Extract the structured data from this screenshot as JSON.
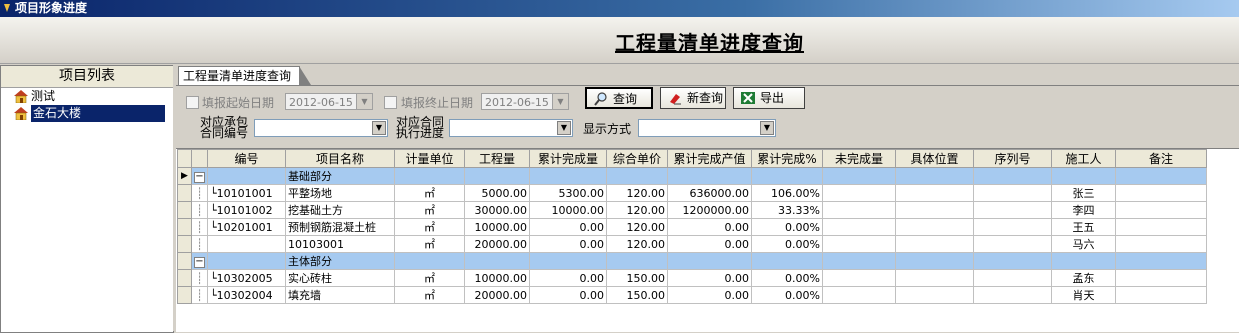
{
  "window": {
    "title": "项目形象进度"
  },
  "page": {
    "title": "工程量清单进度查询"
  },
  "sidebar": {
    "header": "项目列表",
    "items": [
      {
        "label": "测试"
      },
      {
        "label": "金石大楼"
      }
    ]
  },
  "tab": {
    "label": "工程量清单进度查询"
  },
  "filters": {
    "start_label": "填报起始日期",
    "start_value": "2012-06-15",
    "end_label": "填报终止日期",
    "end_value": "2012-06-15",
    "contract_label_1": "对应承包",
    "contract_label_2": "合同编号",
    "contract_value": "",
    "progress_label_1": "对应合同",
    "progress_label_2": "执行进度",
    "progress_value": "",
    "display_label": "显示方式",
    "display_value": ""
  },
  "buttons": {
    "query": "查询",
    "new_query": "新查询",
    "export": "导出"
  },
  "colors": {
    "title_bar": "#0a246a",
    "group_row": "#a6caf0",
    "selected": "#0a246a"
  },
  "table": {
    "columns": [
      "编号",
      "项目名称",
      "计量单位",
      "工程量",
      "累计完成量",
      "综合单价",
      "累计完成产值",
      "累计完成%",
      "未完成量",
      "具体位置",
      "序列号",
      "施工人",
      "备注"
    ],
    "rows": [
      {
        "type": "group",
        "name": "基础部分"
      },
      {
        "type": "item",
        "code": "10101001",
        "name": "平整场地",
        "unit": "㎡",
        "qty": "5000.00",
        "done": "5300.00",
        "price": "120.00",
        "value": "636000.00",
        "pct": "106.00%",
        "worker": "张三"
      },
      {
        "type": "item",
        "code": "10101002",
        "name": "挖基础土方",
        "unit": "㎡",
        "qty": "30000.00",
        "done": "10000.00",
        "price": "120.00",
        "value": "1200000.00",
        "pct": "33.33%",
        "worker": "李四"
      },
      {
        "type": "item",
        "code": "10201001",
        "name": "预制钢筋混凝土桩",
        "unit": "㎡",
        "qty": "10000.00",
        "done": "0.00",
        "price": "120.00",
        "value": "0.00",
        "pct": "0.00%",
        "worker": "王五"
      },
      {
        "type": "item",
        "code": "",
        "name": "10103001",
        "unit": "㎡",
        "qty": "20000.00",
        "done": "0.00",
        "price": "120.00",
        "value": "0.00",
        "pct": "0.00%",
        "worker": "马六"
      },
      {
        "type": "group",
        "name": "主体部分"
      },
      {
        "type": "item",
        "code": "10302005",
        "name": "实心砖柱",
        "unit": "㎡",
        "qty": "10000.00",
        "done": "0.00",
        "price": "150.00",
        "value": "0.00",
        "pct": "0.00%",
        "worker": "孟东"
      },
      {
        "type": "item",
        "code": "10302004",
        "name": "填充墙",
        "unit": "㎡",
        "qty": "20000.00",
        "done": "0.00",
        "price": "150.00",
        "value": "0.00",
        "pct": "0.00%",
        "worker": "肖天"
      }
    ]
  }
}
